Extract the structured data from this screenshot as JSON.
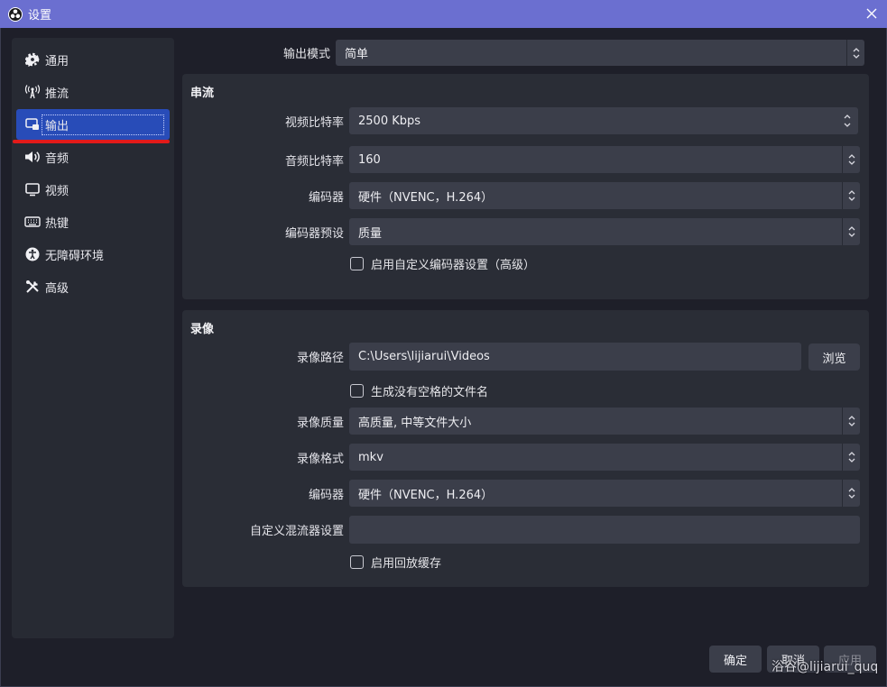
{
  "window": {
    "title": "设置"
  },
  "sidebar": {
    "items": [
      {
        "label": "通用",
        "icon": "gear-icon"
      },
      {
        "label": "推流",
        "icon": "antenna-icon"
      },
      {
        "label": "输出",
        "icon": "output-icon"
      },
      {
        "label": "音频",
        "icon": "speaker-icon"
      },
      {
        "label": "视频",
        "icon": "monitor-icon"
      },
      {
        "label": "热键",
        "icon": "keyboard-icon"
      },
      {
        "label": "无障碍环境",
        "icon": "accessibility-icon"
      },
      {
        "label": "高级",
        "icon": "tools-icon"
      }
    ],
    "active_index": 2
  },
  "output_mode": {
    "label": "输出模式",
    "value": "简单"
  },
  "streaming": {
    "title": "串流",
    "video_bitrate": {
      "label": "视频比特率",
      "value": "2500 Kbps"
    },
    "audio_bitrate": {
      "label": "音频比特率",
      "value": "160"
    },
    "encoder": {
      "label": "编码器",
      "value": "硬件（NVENC，H.264）"
    },
    "encoder_preset": {
      "label": "编码器预设",
      "value": "质量"
    },
    "custom_encoder_checkbox": {
      "label": "启用自定义编码器设置（高级）",
      "checked": false
    }
  },
  "recording": {
    "title": "录像",
    "path": {
      "label": "录像路径",
      "value": "C:\\Users\\lijiarui\\Videos"
    },
    "browse_label": "浏览",
    "no_space_checkbox": {
      "label": "生成没有空格的文件名",
      "checked": false
    },
    "quality": {
      "label": "录像质量",
      "value": "高质量, 中等文件大小"
    },
    "format": {
      "label": "录像格式",
      "value": "mkv"
    },
    "encoder": {
      "label": "编码器",
      "value": "硬件（NVENC，H.264）"
    },
    "muxer": {
      "label": "自定义混流器设置",
      "value": ""
    },
    "replay_checkbox": {
      "label": "启用回放缓存",
      "checked": false
    }
  },
  "footer": {
    "ok": "确定",
    "cancel": "取消",
    "apply": "应用"
  },
  "watermark": "浴谷@lijiarui_quq",
  "colors": {
    "titlebar": "#6b6fd0",
    "accent": "#284cb8",
    "annotation_underline": "#e21a1a"
  }
}
